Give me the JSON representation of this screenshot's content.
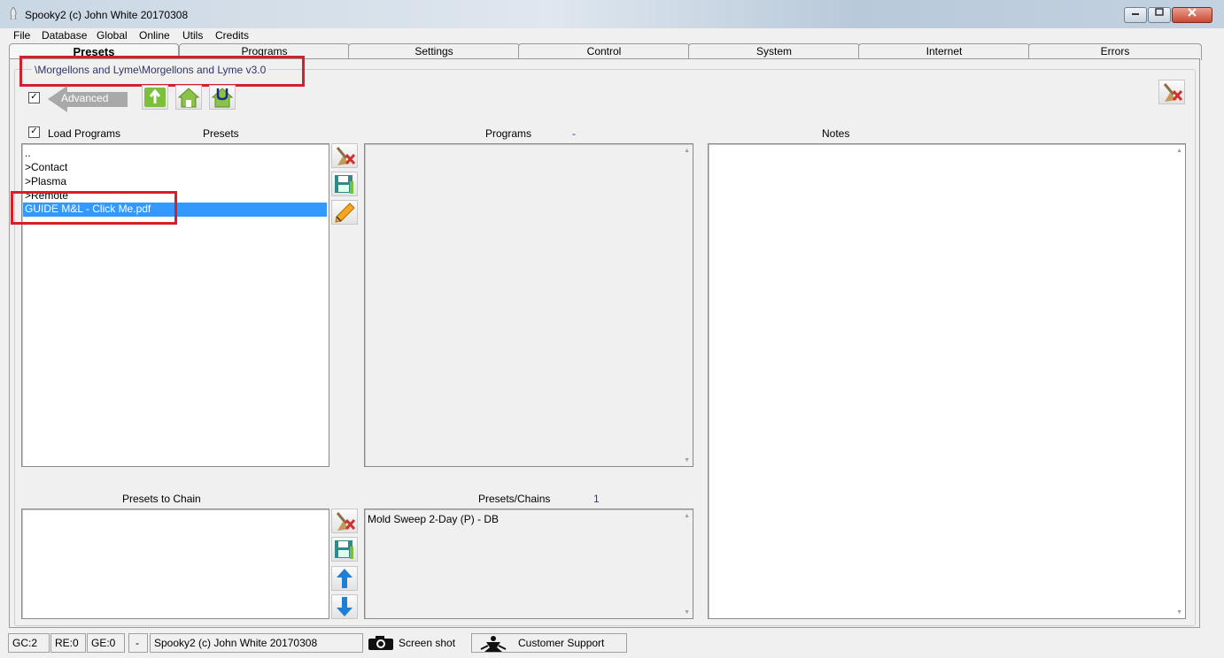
{
  "window": {
    "title": "Spooky2 (c) John White 20170308"
  },
  "menu": [
    "File",
    "Database",
    "Global",
    "Online",
    "Utils",
    "Credits"
  ],
  "tabs": [
    "Presets",
    "Programs",
    "Settings",
    "Control",
    "System",
    "Internet",
    "Errors"
  ],
  "path": "\\Morgellons and Lyme\\Morgellons and Lyme v3.0",
  "advanced": {
    "label": "Advanced",
    "checked": "✓"
  },
  "load_programs": {
    "label": "Load Programs",
    "checked": "✓"
  },
  "presets": {
    "header": "Presets",
    "items": [
      "..",
      ">Contact",
      ">Plasma",
      ">Remote",
      "GUIDE M&L - Click Me.pdf"
    ],
    "selected": "GUIDE M&L - Click Me.pdf"
  },
  "programs": {
    "header": "Programs",
    "count": "-"
  },
  "notes": {
    "header": "Notes"
  },
  "chain": {
    "header": "Presets to Chain"
  },
  "presets_chains": {
    "header": "Presets/Chains",
    "count": "1",
    "items": [
      "Mold Sweep 2-Day (P) - DB"
    ]
  },
  "status": {
    "gc": "GC:2",
    "re": "RE:0",
    "ge": "GE:0",
    "dash": "-",
    "copyright": "Spooky2 (c) John White 20170308",
    "screenshot": "Screen shot",
    "support": "Customer Support"
  },
  "colors": {
    "selection": "#3399ff",
    "highlight": "#d4202a",
    "arrow": "#1e7fd6",
    "icon_green": "#8bc34a"
  }
}
